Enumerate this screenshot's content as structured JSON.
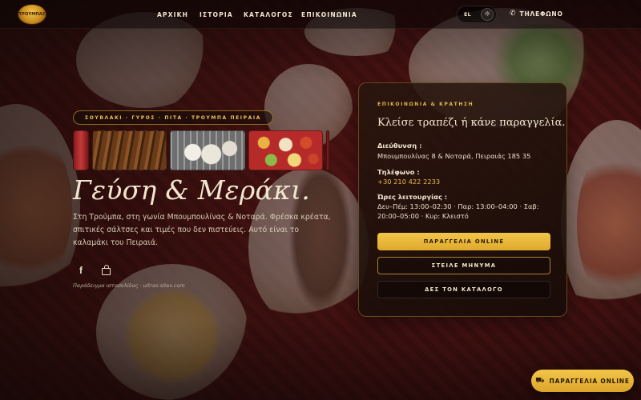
{
  "header": {
    "logo_text": "ΤΡΟΥΜΠΑΣ",
    "nav": [
      {
        "label": "ΑΡΧΙΚΗ"
      },
      {
        "label": "ΙΣΤΟΡΙΑ"
      },
      {
        "label": "ΚΑΤΑΛΟΓΟΣ"
      },
      {
        "label": "ΕΠΙΚΟΙΝΩΝΙΑ"
      }
    ],
    "language": "EL",
    "theme_icon": "sun-icon",
    "phone_icon": "phone-icon",
    "phone_label": "ΤΗΛΕΦΩΝΟ"
  },
  "hero": {
    "tagline": "ΣΟΥΒΛΑΚΙ · ΓΥΡΟΣ · ΠΙΤΑ · ΤΡΟΥΜΠΑ ΠΕΙΡΑΙΑ",
    "title": "Γεύση & Μεράκι.",
    "description": "Στη Τρούμπα, στη γωνία Μπουμπουλίνας & Νοταρά. Φρέσκα κρέατα, σπιτικές σάλτσες και τιμές που δεν πιστεύεις. Αυτό είναι το καλαμάκι του Πειραιά.",
    "social": [
      {
        "icon": "facebook-icon",
        "glyph": "f"
      },
      {
        "icon": "shopping-bag-icon"
      }
    ],
    "credit": "Παράδειγμα ιστοσελίδας · ultras-sites.com"
  },
  "contact_card": {
    "eyebrow": "ΕΠΙΚΟΙΝΩΝΙΑ & ΚΡΑΤΗΣΗ",
    "title": "Κλείσε τραπέζι ή κάνε παραγγελία.",
    "address_label": "Διεύθυνση :",
    "address_value": "Μπουμπουλίνας 8 & Νοταρά, Πειραιάς 185 35",
    "phone_label": "Τηλέφωνο :",
    "phone_value": "+30 210 422 2233",
    "hours_label": "Ώρες λειτουργίας :",
    "hours_line1": "Δευ–Πέμ: 13:00–02:30 · Παρ: 13:00–04:00 · Σαβ:",
    "hours_line2": "20:00–05:00 · Κυρ: Κλειστό",
    "buttons": [
      {
        "label": "ΠΑΡΑΓΓΕΛΙΑ ONLINE"
      },
      {
        "label": "ΣΤΕΙΛΕ ΜΗΝΥΜΑ"
      },
      {
        "label": "ΔΕΣ ΤΟΝ ΚΑΤΑΛΟΓΟ"
      }
    ]
  },
  "floating_order": {
    "icon": "bag-icon",
    "label": "ΠΑΡΑΓΓΕΛΙΑ ONLINE"
  }
}
